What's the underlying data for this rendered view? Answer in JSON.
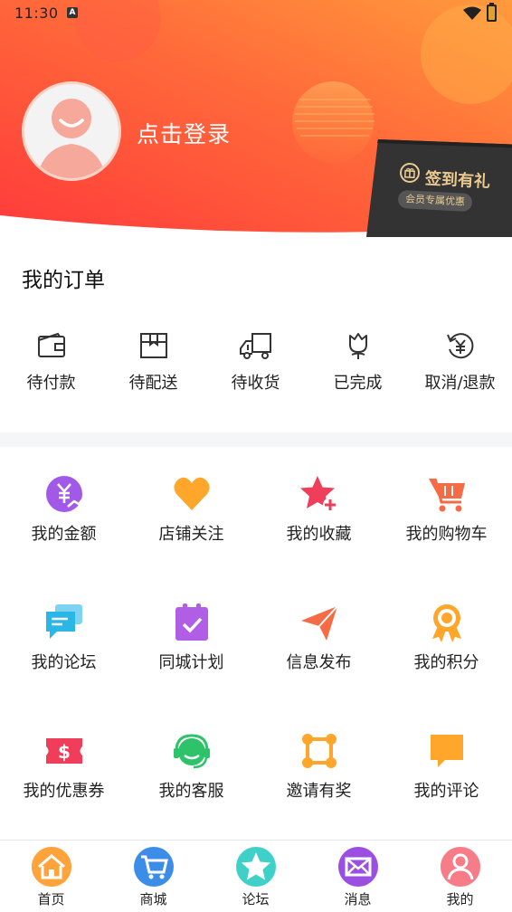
{
  "status_bar": {
    "time": "11:30",
    "notification_badge": "A"
  },
  "header": {
    "login_text": "点击登录",
    "checkin": {
      "title": "签到有礼",
      "subtitle": "会员专属优惠"
    },
    "colors": {
      "gradient_start": "#ff3f3f",
      "gradient_end": "#ff9a3c"
    }
  },
  "orders": {
    "title": "我的订单",
    "items": [
      {
        "label": "待付款",
        "icon": "wallet-icon"
      },
      {
        "label": "待配送",
        "icon": "box-icon"
      },
      {
        "label": "待收货",
        "icon": "truck-icon"
      },
      {
        "label": "已完成",
        "icon": "flower-icon"
      },
      {
        "label": "取消/退款",
        "icon": "refund-icon"
      }
    ]
  },
  "services": [
    {
      "label": "我的金额",
      "icon": "money-icon",
      "color": "#a259e8"
    },
    {
      "label": "店铺关注",
      "icon": "heart-icon",
      "color": "#ffa62b"
    },
    {
      "label": "我的收藏",
      "icon": "star-add-icon",
      "color": "#ef3d5a"
    },
    {
      "label": "我的购物车",
      "icon": "cart-icon",
      "color": "#f46b45"
    },
    {
      "label": "我的论坛",
      "icon": "chat-icon",
      "color": "#2bb6e8"
    },
    {
      "label": "同城计划",
      "icon": "clipboard-check-icon",
      "color": "#b05ee6"
    },
    {
      "label": "信息发布",
      "icon": "paper-plane-icon",
      "color": "#f46b45"
    },
    {
      "label": "我的积分",
      "icon": "medal-icon",
      "color": "#ffa62b"
    },
    {
      "label": "我的优惠券",
      "icon": "coupon-icon",
      "color": "#ef3d5a"
    },
    {
      "label": "我的客服",
      "icon": "headset-icon",
      "color": "#2ec36b"
    },
    {
      "label": "邀请有奖",
      "icon": "share-nodes-icon",
      "color": "#ffa62b"
    },
    {
      "label": "我的评论",
      "icon": "comment-icon",
      "color": "#ffa62b"
    }
  ],
  "tabbar": [
    {
      "label": "首页",
      "icon": "home-icon",
      "color": "#ff8a2b"
    },
    {
      "label": "商城",
      "icon": "shop-cart-icon",
      "color": "#3b8de8"
    },
    {
      "label": "论坛",
      "icon": "forum-star-icon",
      "color": "#3fd1c7"
    },
    {
      "label": "消息",
      "icon": "mail-icon",
      "color": "#9b4fe0"
    },
    {
      "label": "我的",
      "icon": "profile-icon",
      "color": "#f2607a"
    }
  ]
}
